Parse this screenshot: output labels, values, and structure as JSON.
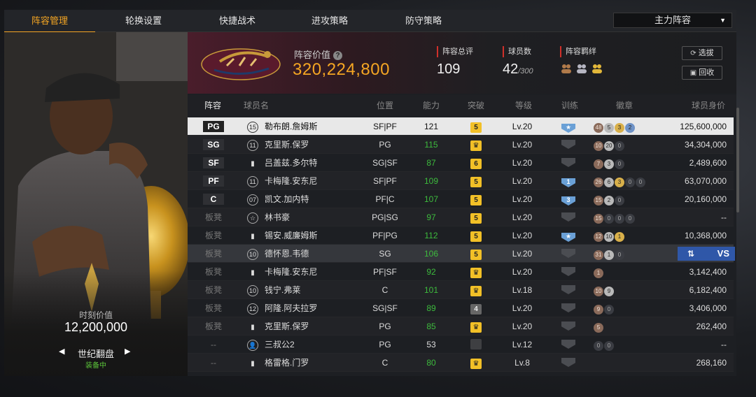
{
  "tabs": [
    "阵容管理",
    "轮换设置",
    "快捷战术",
    "进攻策略",
    "防守策略"
  ],
  "lineup_select": {
    "value": "主力阵容"
  },
  "player_card": {
    "moment_label": "时刻价值",
    "moment_value": "12,200,000",
    "card_name": "世纪翻盘",
    "status": "装备中"
  },
  "header": {
    "value_label": "阵容价值",
    "value": "320,224,800",
    "rating_label": "阵容总评",
    "rating": "109",
    "count_label": "球员数",
    "count": "42",
    "count_max": "/300",
    "bond_label": "阵容羁绊",
    "select_button": "选拔",
    "recycle_button": "回收"
  },
  "table": {
    "headers": {
      "lineup": "阵容",
      "name": "球员名",
      "position": "位置",
      "ability": "能力",
      "breakthrough": "突破",
      "level": "等级",
      "training": "训练",
      "badges": "徽章",
      "salary": "球员身价"
    },
    "rows": [
      {
        "slot": "PG",
        "num": "15",
        "name": "勒布朗.詹姆斯",
        "pos": "SF|PF",
        "ovr": "121",
        "brk": "5",
        "lv": "Lv.20",
        "train": "★",
        "badges": [
          "48",
          "5",
          "3",
          "2"
        ],
        "salary": "125,600,000"
      },
      {
        "slot": "SG",
        "num": "11",
        "name": "克里斯.保罗",
        "pos": "PG",
        "ovr": "115",
        "brk": "♛",
        "lv": "Lv.20",
        "train": "",
        "badges": [
          "10",
          "20",
          "0"
        ],
        "salary": "34,304,000"
      },
      {
        "slot": "SF",
        "num": "",
        "name": "吕盖兹.多尔特",
        "pos": "SG|SF",
        "ovr": "87",
        "brk": "6",
        "lv": "Lv.20",
        "train": "",
        "badges": [
          "7",
          "3",
          "0"
        ],
        "salary": "2,489,600"
      },
      {
        "slot": "PF",
        "num": "11",
        "name": "卡梅隆.安东尼",
        "pos": "SF|PF",
        "ovr": "109",
        "brk": "5",
        "lv": "Lv.20",
        "train": "1",
        "badges": [
          "26",
          "6",
          "3",
          "0",
          "0"
        ],
        "salary": "63,070,000"
      },
      {
        "slot": "C",
        "num": "07",
        "name": "凯文.加内特",
        "pos": "PF|C",
        "ovr": "107",
        "brk": "5",
        "lv": "Lv.20",
        "train": "3",
        "badges": [
          "15",
          "2",
          "0"
        ],
        "salary": "20,160,000"
      },
      {
        "slot": "板凳",
        "num": "☆",
        "name": "林书豪",
        "pos": "PG|SG",
        "ovr": "97",
        "brk": "5",
        "lv": "Lv.20",
        "train": "",
        "badges": [
          "15",
          "0",
          "0",
          "0"
        ],
        "salary": "--"
      },
      {
        "slot": "板凳",
        "num": "",
        "name": "锡安.威廉姆斯",
        "pos": "PF|PG",
        "ovr": "112",
        "brk": "5",
        "lv": "Lv.20",
        "train": "★",
        "badges": [
          "12",
          "10",
          "1"
        ],
        "salary": "10,368,000"
      },
      {
        "slot": "板凳",
        "num": "10",
        "name": "德怀恩.韦德",
        "pos": "SG",
        "ovr": "106",
        "brk": "5",
        "lv": "Lv.20",
        "train": "",
        "badges": [
          "31",
          "1",
          "0"
        ],
        "salary": "VS"
      },
      {
        "slot": "板凳",
        "num": "",
        "name": "卡梅隆.安东尼",
        "pos": "PF|SF",
        "ovr": "92",
        "brk": "♛",
        "lv": "Lv.20",
        "train": "",
        "badges": [
          "1"
        ],
        "salary": "3,142,400"
      },
      {
        "slot": "板凳",
        "num": "10",
        "name": "钱宁.弗莱",
        "pos": "C",
        "ovr": "101",
        "brk": "♛",
        "lv": "Lv.18",
        "train": "",
        "badges": [
          "10",
          "9"
        ],
        "salary": "6,182,400"
      },
      {
        "slot": "板凳",
        "num": "12",
        "name": "阿隆.阿夫拉罗",
        "pos": "SG|SF",
        "ovr": "89",
        "brk": "4",
        "lv": "Lv.20",
        "train": "",
        "badges": [
          "9",
          "0"
        ],
        "salary": "3,406,000"
      },
      {
        "slot": "板凳",
        "num": "",
        "name": "克里斯.保罗",
        "pos": "PG",
        "ovr": "85",
        "brk": "♛",
        "lv": "Lv.20",
        "train": "",
        "badges": [
          "5"
        ],
        "salary": "262,400"
      },
      {
        "slot": "--",
        "num": "👤",
        "name": "三叔公2",
        "pos": "PG",
        "ovr": "53",
        "brk": "",
        "lv": "Lv.12",
        "train": "",
        "badges": [
          "0",
          "0"
        ],
        "salary": "--"
      },
      {
        "slot": "--",
        "num": "",
        "name": "格雷格.门罗",
        "pos": "C",
        "ovr": "80",
        "brk": "♛",
        "lv": "Lv.8",
        "train": "",
        "badges": [],
        "salary": "268,160"
      }
    ]
  },
  "colors": {
    "accent": "#f5a623",
    "green": "#3dbb3d",
    "red": "#d0302a",
    "vs_blue": "#2f57a8"
  }
}
